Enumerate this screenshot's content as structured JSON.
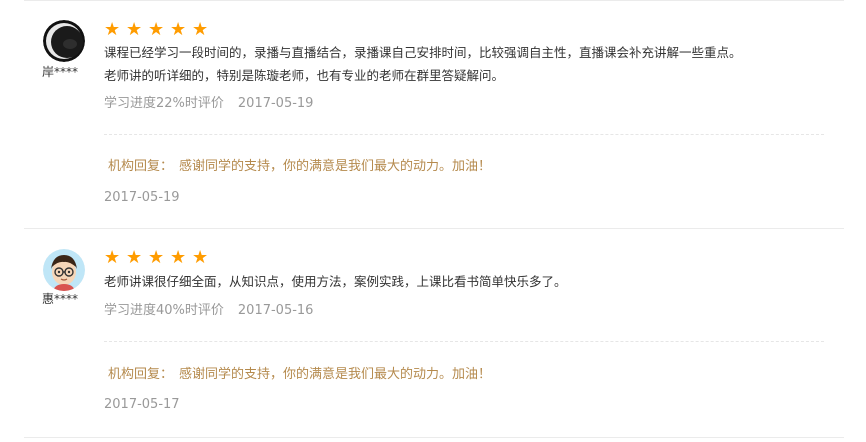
{
  "star_color": "#ff9c00",
  "reply_color": "#b58a4d",
  "reviews": [
    {
      "user": "岸****",
      "avatar_icon": "moon-avatar-icon",
      "rating": 5,
      "comment_lines": [
        "课程已经学习一段时间的，录播与直播结合，录播课自己安排时间，比较强调自主性，直播课会补充讲解一些重点。",
        "老师讲的听详细的，特别是陈璇老师，也有专业的老师在群里答疑解问。"
      ],
      "progress": "学习进度22%时评价",
      "date": "2017-05-19",
      "reply_label": "机构回复：",
      "reply_text": "感谢同学的支持，你的满意是我们最大的动力。加油！",
      "reply_date": "2017-05-19"
    },
    {
      "user": "惠****",
      "avatar_icon": "cartoon-boy-avatar-icon",
      "rating": 5,
      "comment_lines": [
        "老师讲课很仔细全面，从知识点，使用方法，案例实践，上课比看书简单快乐多了。"
      ],
      "progress": "学习进度40%时评价",
      "date": "2017-05-16",
      "reply_label": "机构回复：",
      "reply_text": "感谢同学的支持，你的满意是我们最大的动力。加油！",
      "reply_date": "2017-05-17"
    }
  ]
}
